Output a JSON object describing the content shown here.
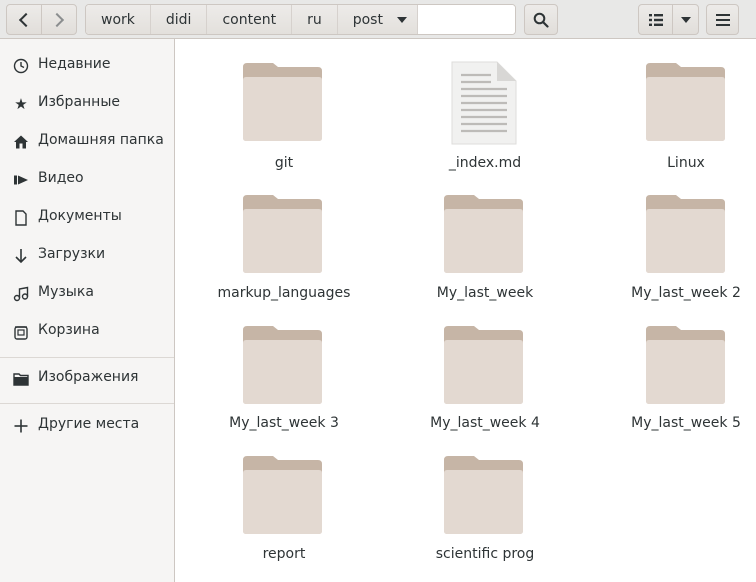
{
  "header": {
    "nav_back_icon": "go-previous-icon",
    "nav_forward_icon": "go-next-icon",
    "path": [
      "work",
      "didi",
      "content",
      "ru",
      "post"
    ],
    "search_icon": "search-icon",
    "view_icon": "list-view-icon",
    "view_menu_icon": "chevron-down-icon",
    "main_menu_icon": "hamburger-menu-icon"
  },
  "sidebar": {
    "items": [
      {
        "label": "Недавние",
        "icon": "recent-icon"
      },
      {
        "label": "Избранные",
        "icon": "star-icon"
      },
      {
        "label": "Домашняя папка",
        "icon": "home-icon"
      },
      {
        "label": "Видео",
        "icon": "video-icon"
      },
      {
        "label": "Документы",
        "icon": "document-icon"
      },
      {
        "label": "Загрузки",
        "icon": "download-icon"
      },
      {
        "label": "Музыка",
        "icon": "music-icon"
      },
      {
        "label": "Корзина",
        "icon": "trash-icon"
      },
      {
        "label": "Изображения",
        "icon": "folder-icon"
      },
      {
        "label": "Другие места",
        "icon": "plus-icon"
      }
    ]
  },
  "files": [
    {
      "name": "git",
      "type": "folder"
    },
    {
      "name": "_index.md",
      "type": "document"
    },
    {
      "name": "Linux",
      "type": "folder"
    },
    {
      "name": "markup_languages",
      "type": "folder"
    },
    {
      "name": "My_last_week",
      "type": "folder"
    },
    {
      "name": "My_last_week 2",
      "type": "folder"
    },
    {
      "name": "My_last_week 3",
      "type": "folder"
    },
    {
      "name": "My_last_week 4",
      "type": "folder"
    },
    {
      "name": "My_last_week 5",
      "type": "folder"
    },
    {
      "name": "report",
      "type": "folder"
    },
    {
      "name": "scientific prog",
      "type": "folder"
    }
  ],
  "colors": {
    "folder_back": "#c6b5a6",
    "folder_front": "#e3d9d1",
    "headerbar": "#e8e8e7",
    "sidebar": "#f6f5f4"
  }
}
